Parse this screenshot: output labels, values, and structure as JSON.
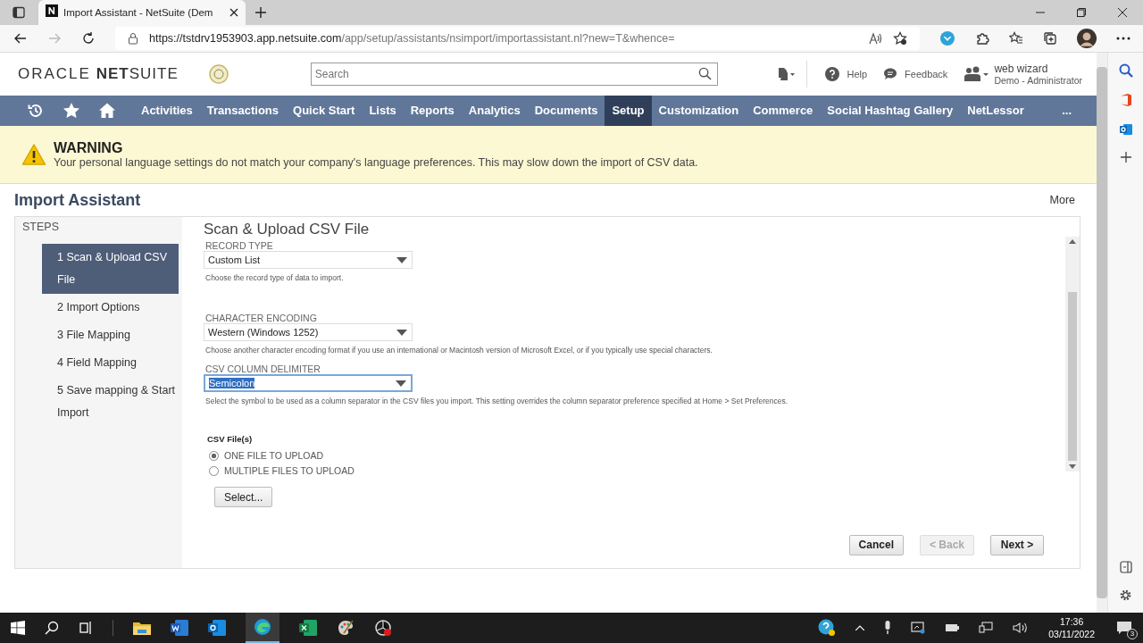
{
  "browser": {
    "tab_title": "Import Assistant - NetSuite (Dem",
    "url_host": "https://tstdrv1953903.app.netsuite.com",
    "url_path": "/app/setup/assistants/nsimport/importassistant.nl?new=T&whence="
  },
  "header": {
    "brand": "ORACLE",
    "product": "**NET**SUITE",
    "search_placeholder": "Search",
    "help": "Help",
    "feedback": "Feedback",
    "user_name": "web wizard",
    "user_role": "Demo - Administrator"
  },
  "nav": {
    "items": [
      {
        "label": "Activities",
        "selected": false
      },
      {
        "label": "Transactions",
        "selected": false
      },
      {
        "label": "Quick Start",
        "selected": false
      },
      {
        "label": "Lists",
        "selected": false
      },
      {
        "label": "Reports",
        "selected": false
      },
      {
        "label": "Analytics",
        "selected": false
      },
      {
        "label": "Documents",
        "selected": false
      },
      {
        "label": "Setup",
        "selected": true
      },
      {
        "label": "Customization",
        "selected": false
      },
      {
        "label": "Commerce",
        "selected": false
      },
      {
        "label": "Social Hashtag Gallery",
        "selected": false
      },
      {
        "label": "NetLessor",
        "selected": false
      }
    ],
    "more": "..."
  },
  "warning": {
    "title": "WARNING",
    "message": "Your personal language settings do not match your company's language preferences. This may slow down the import of CSV data."
  },
  "page": {
    "title": "Import Assistant",
    "more": "More"
  },
  "steps": {
    "heading": "STEPS",
    "items": [
      {
        "label": "1 Scan & Upload CSV File",
        "selected": true
      },
      {
        "label": "2 Import Options",
        "selected": false
      },
      {
        "label": "3 File Mapping",
        "selected": false
      },
      {
        "label": "4 Field Mapping",
        "selected": false
      },
      {
        "label": "5 Save mapping & Start Import",
        "selected": false
      }
    ]
  },
  "form": {
    "heading": "Scan & Upload CSV File",
    "fields": [
      {
        "label": "RECORD TYPE",
        "value": "Custom List",
        "help": "Choose the record type of data to import.",
        "focused": false
      },
      {
        "label": "CHARACTER ENCODING",
        "value": "Western (Windows 1252)",
        "help": "Choose another character encoding format if you use an international or Macintosh version of Microsoft Excel, or if you typically use special characters.",
        "focused": false
      },
      {
        "label": "CSV COLUMN DELIMITER",
        "value": "Semicolon",
        "help": "Select the symbol to be used as a column separator in the CSV files you import. This setting overrides the column separator preference specified at Home > Set Preferences.",
        "focused": true
      }
    ],
    "files_label": "CSV File(s)",
    "file_options": [
      {
        "label": "ONE FILE TO UPLOAD",
        "selected": true
      },
      {
        "label": "MULTIPLE FILES TO UPLOAD",
        "selected": false
      }
    ],
    "select_button": "Select..."
  },
  "buttons": [
    {
      "label": "Cancel",
      "disabled": false
    },
    {
      "label": "< Back",
      "disabled": true
    },
    {
      "label": "Next >",
      "disabled": false
    }
  ],
  "taskbar": {
    "time": "17:36",
    "date": "03/11/2022",
    "notifications": "3"
  }
}
